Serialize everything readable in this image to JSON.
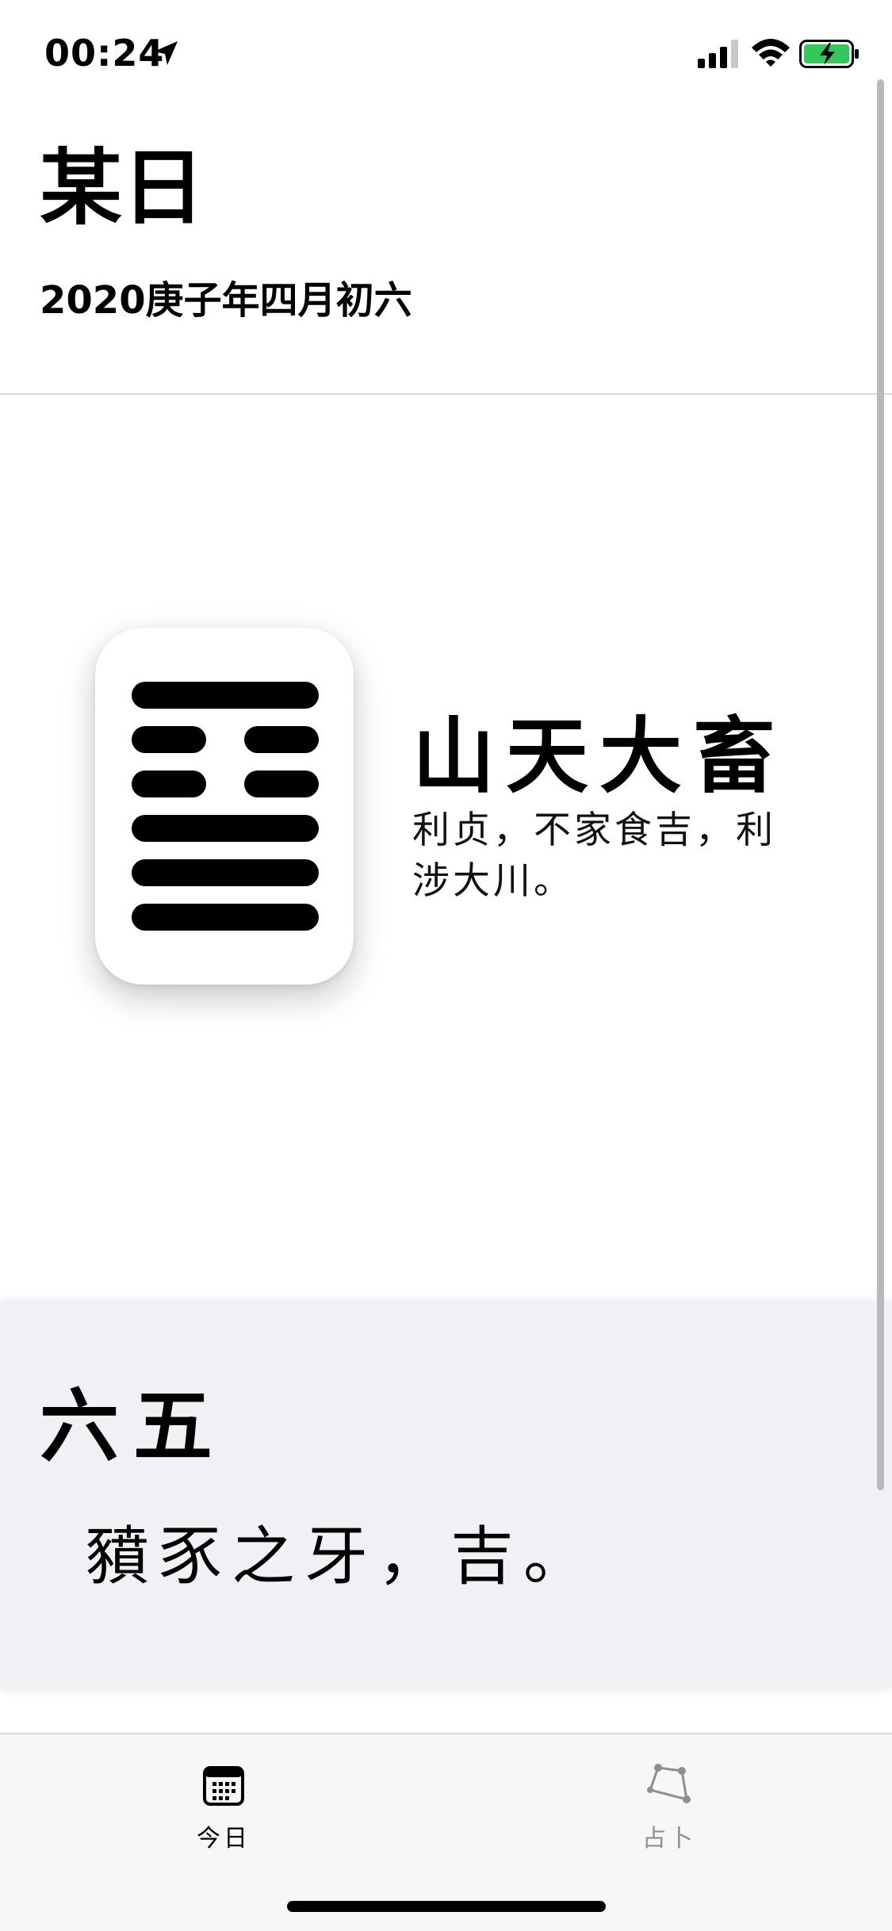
{
  "status_bar": {
    "time": "00:24",
    "icons": [
      "location-arrow-icon",
      "signal-icon",
      "wifi-icon",
      "battery-charging-icon"
    ],
    "battery_color": "#34c759"
  },
  "header": {
    "title": "某日",
    "subtitle": "2020庚子年四月初六"
  },
  "hexagram": {
    "name": "山天大畜",
    "judgment": "利贞，不家食吉，利涉大川。",
    "lines_top_to_bottom": [
      "yang",
      "yin",
      "yin",
      "yang",
      "yang",
      "yang"
    ]
  },
  "line_detail": {
    "position": "六五",
    "text": "豶豕之牙，吉。"
  },
  "tab_bar": {
    "tabs": [
      {
        "label": "今日",
        "icon": "calendar-icon",
        "selected": true
      },
      {
        "label": "占卜",
        "icon": "divination-icon",
        "selected": false
      }
    ]
  },
  "colors": {
    "panel_background": "#f0f0f5",
    "inactive_tab": "#8e8e93"
  }
}
